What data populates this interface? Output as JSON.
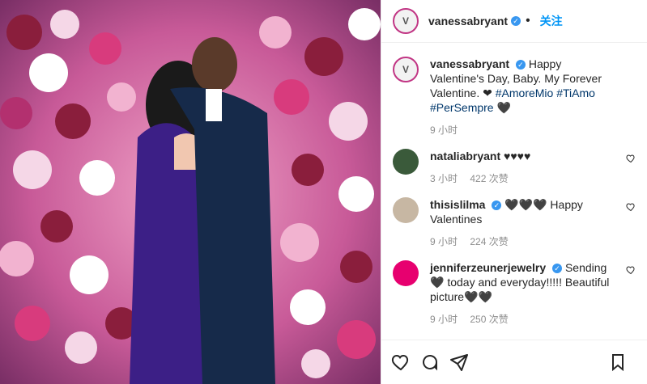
{
  "post": {
    "author": "vanessabryant",
    "follow_label": "关注",
    "caption_author": "vanessabryant",
    "caption_text": "Happy Valentine's Day, Baby. My Forever Valentine. ❤",
    "hashtags": "#AmoreMio #TiAmo #PerSempre",
    "caption_tail": "🖤",
    "caption_time": "9 小时"
  },
  "comments": [
    {
      "user": "nataliabryant",
      "text": "♥♥♥♥",
      "time": "3 小时",
      "likes": "422 次赞"
    },
    {
      "user": "thisislilma",
      "text": "🖤🖤🖤 Happy Valentines",
      "time": "9 小时",
      "likes": "224 次赞"
    },
    {
      "user": "jenniferzeunerjewelry",
      "text": "Sending 🖤 today and everyday!!!!! Beautiful picture🖤🖤",
      "time": "9 小时",
      "likes": "250 次赞"
    }
  ],
  "icons": {
    "verified": "verified-badge",
    "heart": "heart-icon",
    "comment": "comment-icon",
    "share": "share-icon",
    "save": "bookmark-icon"
  }
}
